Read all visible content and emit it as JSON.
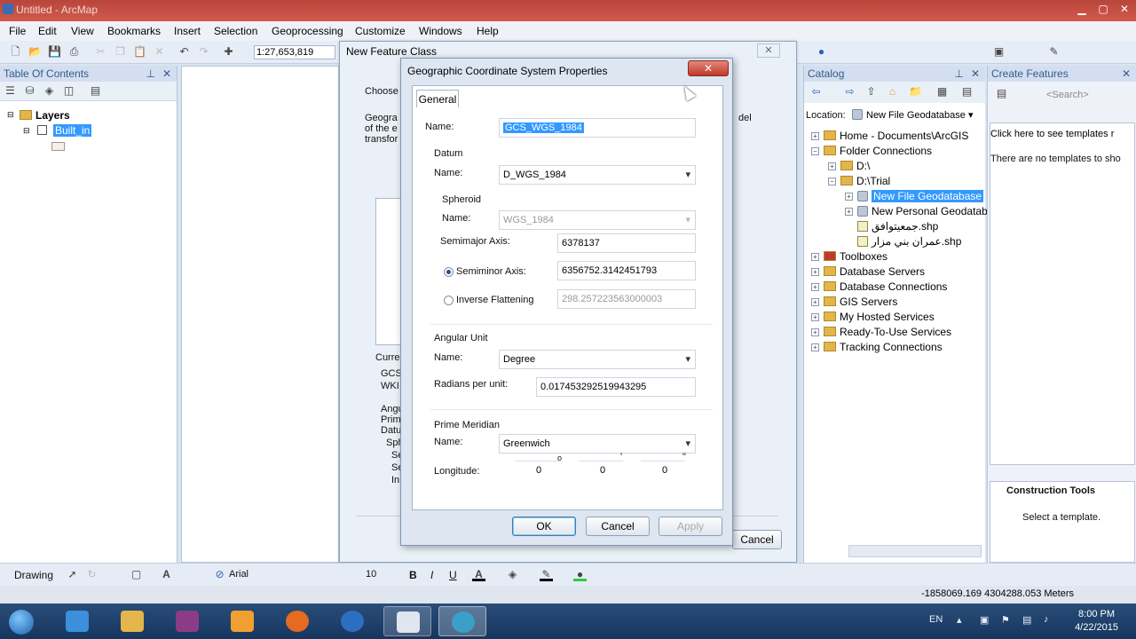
{
  "window": {
    "title": "Untitled - ArcMap"
  },
  "menu": [
    "File",
    "Edit",
    "View",
    "Bookmarks",
    "Insert",
    "Selection",
    "Geoprocessing",
    "Customize",
    "Windows",
    "Help"
  ],
  "toolbar": {
    "scale": "1:27,653,819"
  },
  "toc": {
    "title": "Table Of Contents",
    "layers_label": "Layers",
    "layer_name": "Built_in"
  },
  "new_feature_class": {
    "title": "New Feature Class",
    "choose_label": "Choose",
    "desc_lines": [
      "Geogra",
      "of the e",
      "transfor"
    ],
    "current_label": "Curren",
    "current_lines": [
      "GCS_",
      "WKI"
    ],
    "detail_lines": [
      "Angul",
      "Prime",
      "Datum",
      "Sph",
      "Se",
      "Se",
      "In"
    ],
    "cancel_label": "Cancel",
    "right_text": "del"
  },
  "gcs_dialog": {
    "title": "Geographic Coordinate System Properties",
    "close_label": "✕",
    "tab_general": "General",
    "name_label": "Name:",
    "name_value": "GCS_WGS_1984",
    "datum_label": "Datum",
    "datum_name_label": "Name:",
    "datum_value": "D_WGS_1984",
    "spheroid_label": "Spheroid",
    "spheroid_name_label": "Name:",
    "spheroid_value": "WGS_1984",
    "semimajor_label": "Semimajor Axis:",
    "semimajor_value": "6378137",
    "semiminor_label": "Semiminor Axis:",
    "semiminor_value": "6356752.3142451793",
    "semiminor_selected": true,
    "inverse_label": "Inverse Flattening",
    "inverse_value": "298.257223563000003",
    "angular_label": "Angular Unit",
    "angular_name_label": "Name:",
    "angular_value": "Degree",
    "radians_label": "Radians per unit:",
    "radians_value": "0.017453292519943295",
    "prime_label": "Prime Meridian",
    "prime_name_label": "Name:",
    "prime_value": "Greenwich",
    "longitude_label": "Longitude:",
    "longitude_deg": "0",
    "longitude_min": "0",
    "longitude_sec": "0",
    "deg_symbol": "o",
    "min_symbol": "'",
    "sec_symbol": "\"",
    "ok_label": "OK",
    "cancel_label": "Cancel",
    "apply_label": "Apply"
  },
  "catalog": {
    "title": "Catalog",
    "location_label": "Location:",
    "location_value": "New File Geodatabase",
    "items": [
      {
        "label": "Home - Documents\\ArcGIS",
        "type": "folder"
      },
      {
        "label": "Folder Connections",
        "type": "folder"
      },
      {
        "label": "D:\\",
        "type": "folder"
      },
      {
        "label": "D:\\Trial",
        "type": "folder"
      },
      {
        "label": "New File Geodatabase",
        "type": "gdb"
      },
      {
        "label": "New Personal Geodatab",
        "type": "gdb"
      },
      {
        "label": "جمعيتوافق.shp",
        "type": "shp"
      },
      {
        "label": "عمران بني مزار.shp",
        "type": "shp"
      },
      {
        "label": "Toolboxes",
        "type": "folder"
      },
      {
        "label": "Database Servers",
        "type": "folder"
      },
      {
        "label": "Database Connections",
        "type": "folder"
      },
      {
        "label": "GIS Servers",
        "type": "folder"
      },
      {
        "label": "My Hosted Services",
        "type": "folder"
      },
      {
        "label": "Ready-To-Use Services",
        "type": "folder"
      },
      {
        "label": "Tracking Connections",
        "type": "folder"
      }
    ]
  },
  "create_features": {
    "title": "Create Features",
    "search_placeholder": "<Search>",
    "link": "Click here to see templates r",
    "empty_text": "There are no templates to sho",
    "construction_title": "Construction Tools",
    "construction_text": "Select a template."
  },
  "drawbar": {
    "drawing_label": "Drawing",
    "font_name": "Arial",
    "font_size": "10",
    "bold": "B",
    "italic": "I",
    "underline": "U"
  },
  "status": {
    "coords": "-1858069.169  4304288.053 Meters"
  },
  "taskbar": {
    "lang": "EN",
    "time": "8:00 PM",
    "date": "4/22/2015"
  },
  "colors": {
    "selection": "#3399ff",
    "titlebar": "#c44e42",
    "taskbar": "#1f4270"
  }
}
